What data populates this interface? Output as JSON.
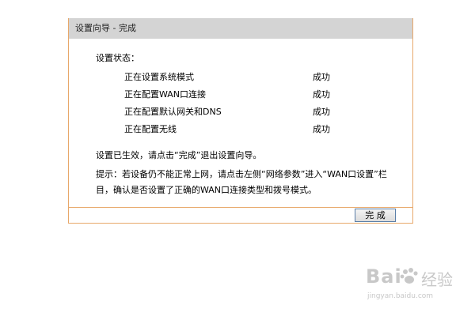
{
  "wizard": {
    "header_title": "设置向导 - 完成",
    "status_title": "设置状态：",
    "steps": [
      {
        "label": "正在设置系统模式",
        "result": "成功"
      },
      {
        "label": "正在配置WAN口连接",
        "result": "成功"
      },
      {
        "label": "正在配置默认网关和DNS",
        "result": "成功"
      },
      {
        "label": "正在配置无线",
        "result": "成功"
      }
    ],
    "effective_note": "设置已生效，请点击“完成”退出设置向导。",
    "tip_note": "提示：若设备仍不能正常上网，请点击左侧“网络参数”进入“WAN口设置”栏目，确认是否设置了正确的WAN口连接类型和拨号模式。",
    "done_button": "完 成"
  },
  "watermark": {
    "logo_text": "Bai",
    "jingyan_text": "经验",
    "url": "jingyan.baidu.com"
  },
  "colors": {
    "header_bg": "#d4d4d4",
    "border": "#e8a86a",
    "button_border": "#5a7ea8"
  }
}
